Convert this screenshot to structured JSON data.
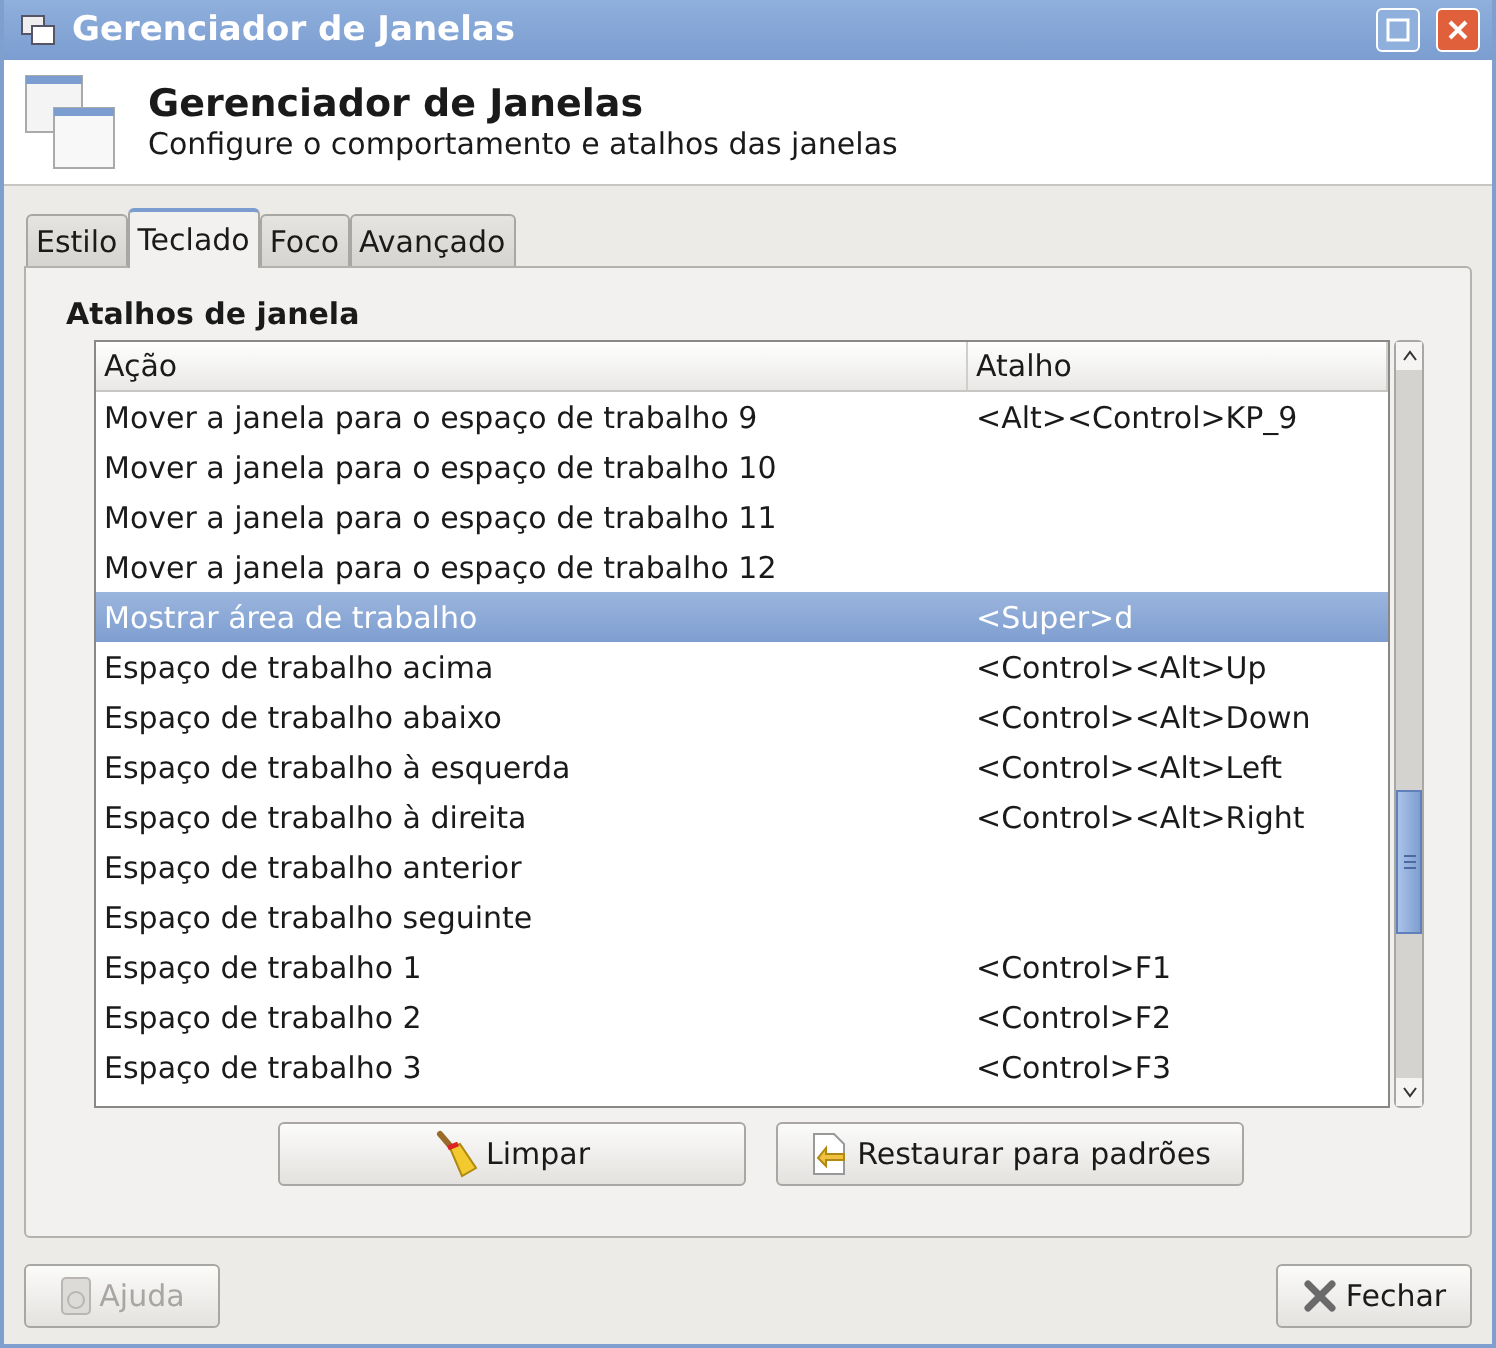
{
  "window": {
    "title": "Gerenciador de Janelas"
  },
  "header": {
    "title": "Gerenciador de Janelas",
    "subtitle": "Configure o comportamento e atalhos das janelas"
  },
  "tabs": [
    {
      "label": "Estilo",
      "selected": false
    },
    {
      "label": "Teclado",
      "selected": true
    },
    {
      "label": "Foco",
      "selected": false
    },
    {
      "label": "Avançado",
      "selected": false
    }
  ],
  "group_label": "Atalhos de janela",
  "table": {
    "columns": [
      "Ação",
      "Atalho"
    ],
    "rows": [
      {
        "action": "Mover a janela para o espaço de trabalho 9",
        "shortcut": "<Alt><Control>KP_9",
        "selected": false
      },
      {
        "action": "Mover a janela para o espaço de trabalho 10",
        "selected": false
      },
      {
        "action": "Mover a janela para o espaço de trabalho 11",
        "selected": false
      },
      {
        "action": "Mover a janela para o espaço de trabalho 12",
        "selected": false
      },
      {
        "action": "Mostrar área de trabalho",
        "shortcut": "<Super>d",
        "selected": true
      },
      {
        "action": "Espaço de trabalho acima",
        "shortcut": "<Control><Alt>Up",
        "selected": false
      },
      {
        "action": "Espaço de trabalho abaixo",
        "shortcut": "<Control><Alt>Down",
        "selected": false
      },
      {
        "action": "Espaço de trabalho à esquerda",
        "shortcut": "<Control><Alt>Left",
        "selected": false
      },
      {
        "action": "Espaço de trabalho à direita",
        "shortcut": "<Control><Alt>Right",
        "selected": false
      },
      {
        "action": "Espaço de trabalho anterior",
        "selected": false
      },
      {
        "action": "Espaço de trabalho seguinte",
        "selected": false
      },
      {
        "action": "Espaço de trabalho 1",
        "shortcut": "<Control>F1",
        "selected": false
      },
      {
        "action": "Espaço de trabalho 2",
        "shortcut": "<Control>F2",
        "selected": false
      },
      {
        "action": "Espaço de trabalho 3",
        "shortcut": "<Control>F3",
        "selected": false
      }
    ]
  },
  "actions": [
    {
      "label": "Limpar",
      "kind": "clear"
    },
    {
      "label": "Restaurar para padrões",
      "kind": "restore"
    }
  ],
  "footer": [
    {
      "label": "Ajuda",
      "kind": "help",
      "disabled": true
    },
    {
      "label": "Fechar",
      "kind": "close",
      "disabled": false
    }
  ]
}
